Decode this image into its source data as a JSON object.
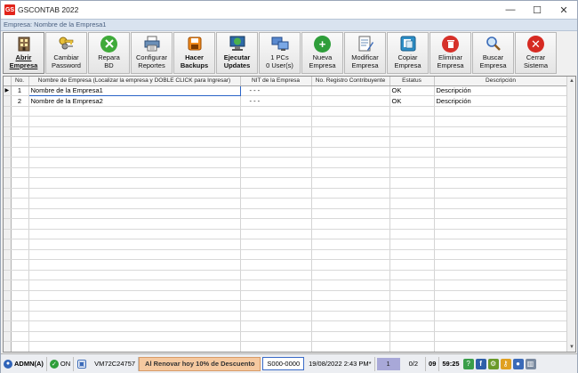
{
  "window": {
    "logo": "GS",
    "title": "GSCONTAB 2022",
    "subtitle": "Empresa: Nombre de la Empresa1",
    "controls": {
      "minimize": "—",
      "maximize": "☐",
      "close": "✕"
    }
  },
  "toolbar": [
    {
      "id": "abrir",
      "label": "Abrir\nEmpresa",
      "icon": "building-icon"
    },
    {
      "id": "cambiar",
      "label": "Cambiar\nPassword",
      "icon": "keys-icon"
    },
    {
      "id": "repara",
      "label": "Repara\nBD",
      "icon": "tools-icon"
    },
    {
      "id": "configurar",
      "label": "Configurar\nReportes",
      "icon": "printer-icon"
    },
    {
      "id": "backups",
      "label": "Hacer\nBackups",
      "icon": "backup-icon"
    },
    {
      "id": "updates",
      "label": "Ejecutar\nUpdates",
      "icon": "globe-icon"
    },
    {
      "id": "users",
      "label": "1 PCs\n0 User(s)",
      "icon": "computers-icon"
    },
    {
      "id": "nueva",
      "label": "Nueva\nEmpresa",
      "icon": "add-icon"
    },
    {
      "id": "modificar",
      "label": "Modificar\nEmpresa",
      "icon": "edit-document-icon"
    },
    {
      "id": "copiar",
      "label": "Copiar\nEmpresa",
      "icon": "copy-icon"
    },
    {
      "id": "eliminar",
      "label": "Eliminar\nEmpresa",
      "icon": "trash-icon"
    },
    {
      "id": "buscar",
      "label": "Buscar\nEmpresa",
      "icon": "search-icon"
    },
    {
      "id": "cerrar",
      "label": "Cerrar\nSistema",
      "icon": "close-icon"
    }
  ],
  "table": {
    "headers": [
      "No.",
      "Nombre de Empresa (Localizar la empresa y DOBLE CLICK para Ingresar)",
      "NIT de la Empresa",
      "No. Registro Contribuyente",
      "Estatus",
      "Descripción"
    ],
    "rows": [
      {
        "no": "1",
        "name": "Nombre de la Empresa1",
        "nit": "-    -  -",
        "registro": "",
        "estatus": "OK",
        "descripcion": "Descripción"
      },
      {
        "no": "2",
        "name": "Nombre de la Empresa2",
        "nit": "-    -  -",
        "registro": "",
        "estatus": "OK",
        "descripcion": "Descripción"
      }
    ],
    "row_indicator": "▶"
  },
  "statusbar": {
    "user": "ADMN(A)",
    "status": "ON",
    "machine": "VM72C24757",
    "promo": "Al Renovar hoy 10% de Descuento",
    "serial": "S000-0000",
    "datetime": "19/08/2022  2:43 PM*",
    "page": "1",
    "pages": "0/2",
    "version": "09",
    "clock": "59:25"
  }
}
